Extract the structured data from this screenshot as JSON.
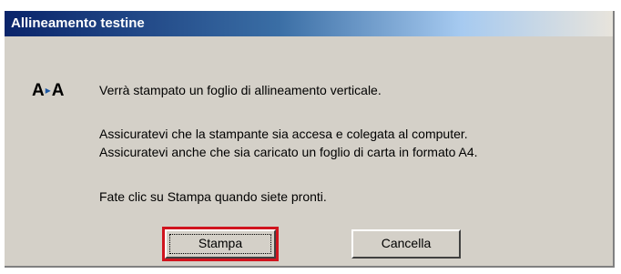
{
  "window": {
    "title": "Allineamento testine"
  },
  "icon": {
    "name": "alignment-icon",
    "left_letter": "A",
    "right_letter": "A",
    "arrow": "▸"
  },
  "message": {
    "line1": "Verrà stampato un foglio di allineamento verticale.",
    "line2": "Assicuratevi che la stampante sia accesa e colegata al computer.",
    "line3": "Assicuratevi anche che sia caricato un foglio di carta in formato A4.",
    "line4": "Fate clic su Stampa quando siete pronti."
  },
  "buttons": {
    "print_label": "Stampa",
    "cancel_label": "Cancella"
  },
  "colors": {
    "highlight": "#d0141e",
    "titlebar": "#0a246a"
  }
}
